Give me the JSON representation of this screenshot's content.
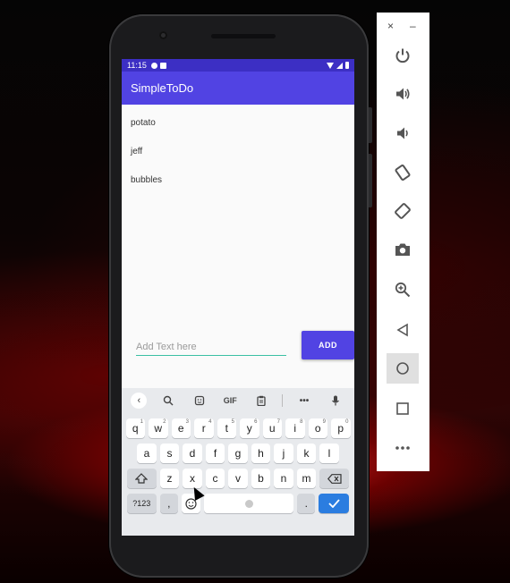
{
  "status_bar": {
    "time": "11:15"
  },
  "app": {
    "title": "SimpleToDo",
    "items": [
      "potato",
      "jeff",
      "bubbles"
    ],
    "input_placeholder": "Add Text here",
    "add_label": "ADD"
  },
  "keyboard": {
    "toolbar": [
      "‹",
      "search-icon",
      "sticker-icon",
      "GIF",
      "clipboard-icon",
      "•••",
      "mic-icon"
    ],
    "gif_label": "GIF",
    "row1": [
      "q",
      "w",
      "e",
      "r",
      "t",
      "y",
      "u",
      "i",
      "o",
      "p"
    ],
    "row1_hints": [
      "1",
      "2",
      "3",
      "4",
      "5",
      "6",
      "7",
      "8",
      "9",
      "0"
    ],
    "row2": [
      "a",
      "s",
      "d",
      "f",
      "g",
      "h",
      "j",
      "k",
      "l"
    ],
    "row3": [
      "z",
      "x",
      "c",
      "v",
      "b",
      "n",
      "m"
    ],
    "sym_label": "?123",
    "comma_label": ",",
    "period_label": ".",
    "colors": {
      "enter": "#2b7de0",
      "accent": "#5143e3"
    }
  },
  "emulator_toolbar": {
    "close_label": "×",
    "minimize_label": "–",
    "buttons": [
      "power-icon",
      "volume-up-icon",
      "volume-down-icon",
      "rotate-left-icon",
      "rotate-right-icon",
      "camera-icon",
      "zoom-icon",
      "back-icon",
      "home-icon",
      "overview-icon",
      "more-icon"
    ]
  }
}
